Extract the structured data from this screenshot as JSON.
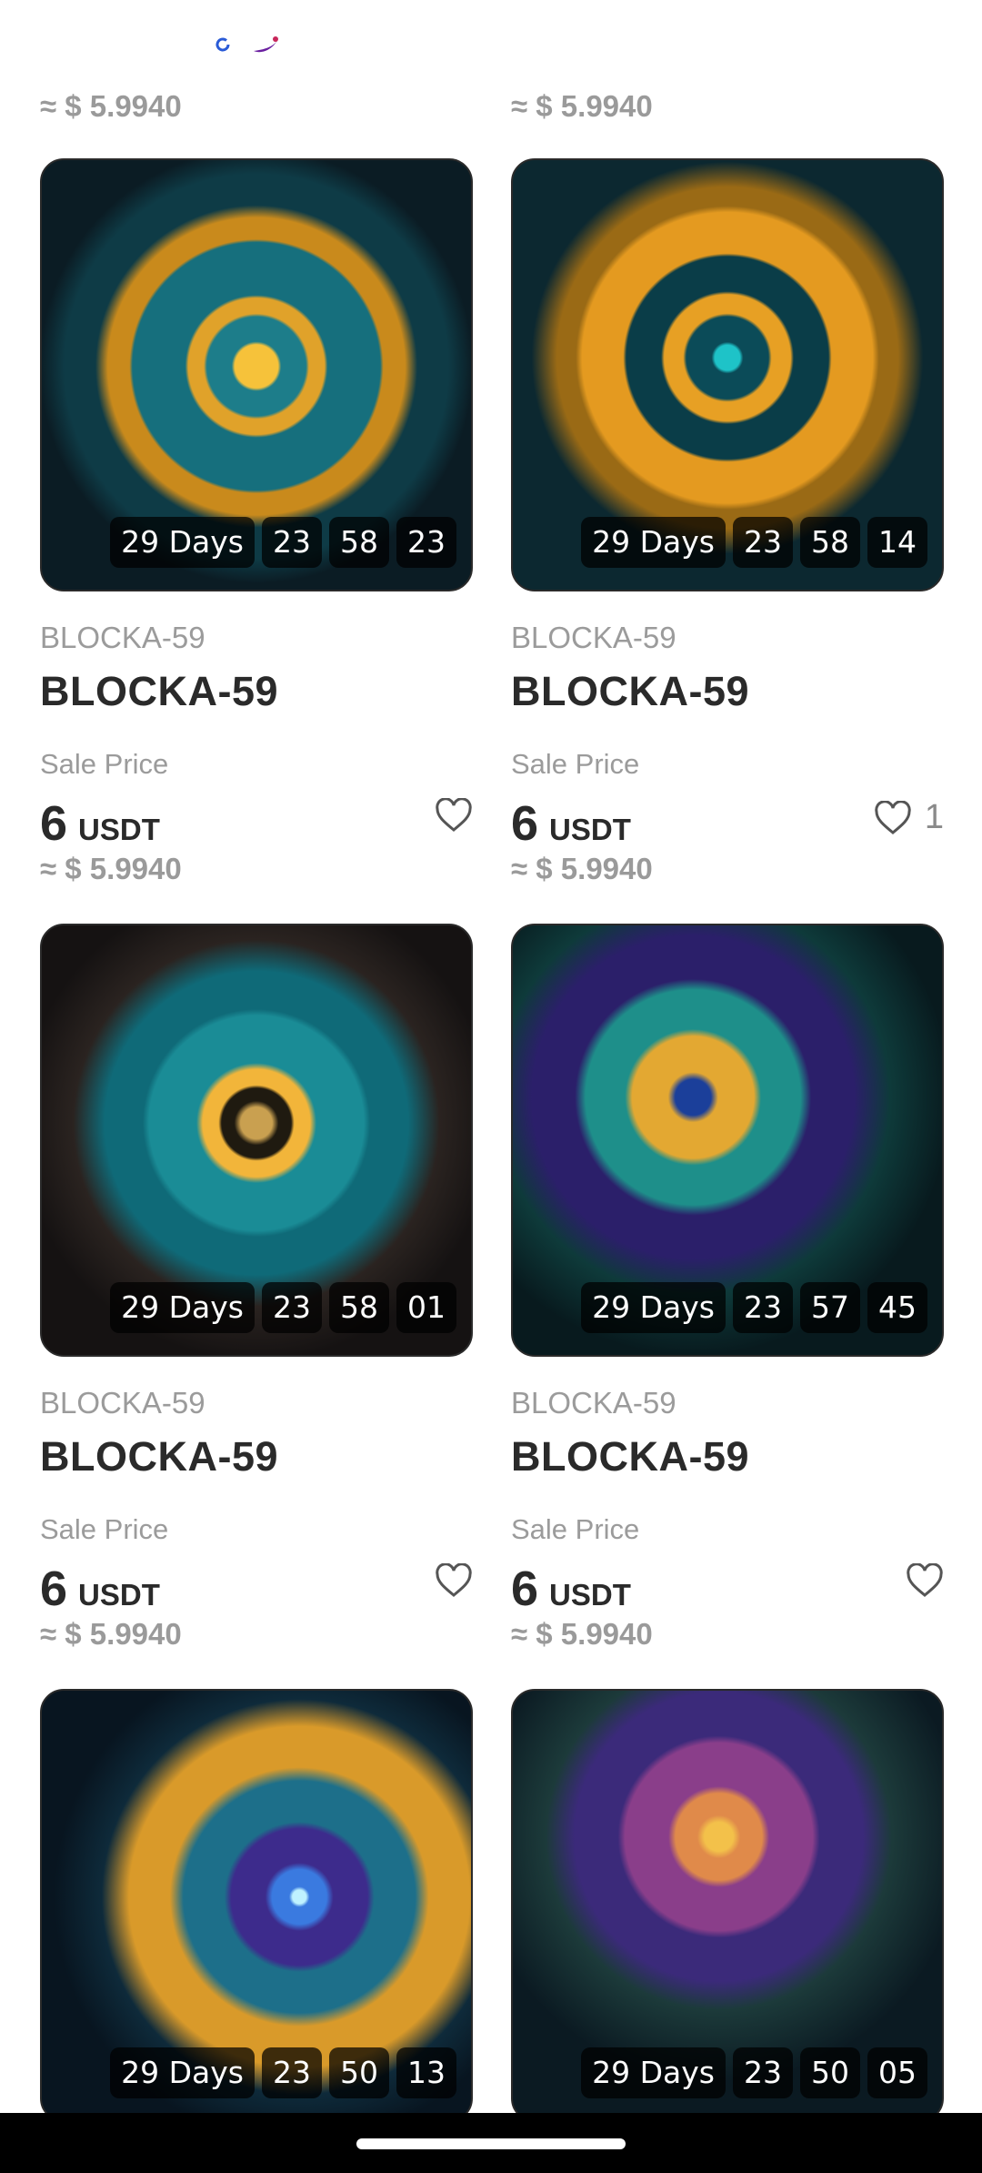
{
  "top_row": {
    "left_usd": "≈ $ 5.9940",
    "right_usd": "≈ $ 5.9940"
  },
  "cards": [
    {
      "collection": "BLOCKA-59",
      "name": "BLOCKA-59",
      "sale_label": "Sale Price",
      "price": "6",
      "unit": "USDT",
      "usd": "≈ $ 5.9940",
      "timer": {
        "days": "29 Days",
        "h": "23",
        "m": "58",
        "s": "23"
      },
      "likes": ""
    },
    {
      "collection": "BLOCKA-59",
      "name": "BLOCKA-59",
      "sale_label": "Sale Price",
      "price": "6",
      "unit": "USDT",
      "usd": "≈ $ 5.9940",
      "timer": {
        "days": "29 Days",
        "h": "23",
        "m": "58",
        "s": "14"
      },
      "likes": "1"
    },
    {
      "collection": "BLOCKA-59",
      "name": "BLOCKA-59",
      "sale_label": "Sale Price",
      "price": "6",
      "unit": "USDT",
      "usd": "≈ $ 5.9940",
      "timer": {
        "days": "29 Days",
        "h": "23",
        "m": "58",
        "s": "01"
      },
      "likes": ""
    },
    {
      "collection": "BLOCKA-59",
      "name": "BLOCKA-59",
      "sale_label": "Sale Price",
      "price": "6",
      "unit": "USDT",
      "usd": "≈ $ 5.9940",
      "timer": {
        "days": "29 Days",
        "h": "23",
        "m": "57",
        "s": "45"
      },
      "likes": ""
    },
    {
      "collection": "",
      "name": "",
      "sale_label": "",
      "price": "",
      "unit": "",
      "usd": "",
      "timer": {
        "days": "29 Days",
        "h": "23",
        "m": "50",
        "s": "13"
      },
      "likes": ""
    },
    {
      "collection": "",
      "name": "",
      "sale_label": "",
      "price": "",
      "unit": "",
      "usd": "",
      "timer": {
        "days": "29 Days",
        "h": "23",
        "m": "50",
        "s": "05"
      },
      "likes": ""
    }
  ],
  "icons": {
    "like": "heart-outline-icon"
  },
  "colors": {
    "muted_text": "#9b9b9b",
    "dark_text": "#2a2a2a",
    "timer_bg": "#000000"
  }
}
